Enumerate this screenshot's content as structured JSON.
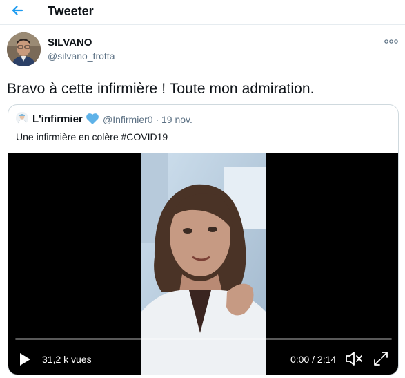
{
  "header": {
    "title": "Tweeter",
    "back_icon": "arrow-left-icon"
  },
  "tweet": {
    "author_name": "SILVANO",
    "author_handle": "@silvano_trotta",
    "text": "Bravo à cette infirmière ! Toute mon admiration."
  },
  "quoted_tweet": {
    "author_name": "L'infirmier",
    "badge_icon": "blue-heart-icon",
    "handle_date": "@Infirmier0 · 19 nov.",
    "text": "Une infirmière en colère #COVID19"
  },
  "video": {
    "views": "31,2 k vues",
    "time": "0:00 / 2:14",
    "progress": 0.0
  },
  "colors": {
    "accent": "#1d9bf0",
    "heart": "#5eb2e8",
    "secondary_text": "#5b7083"
  }
}
